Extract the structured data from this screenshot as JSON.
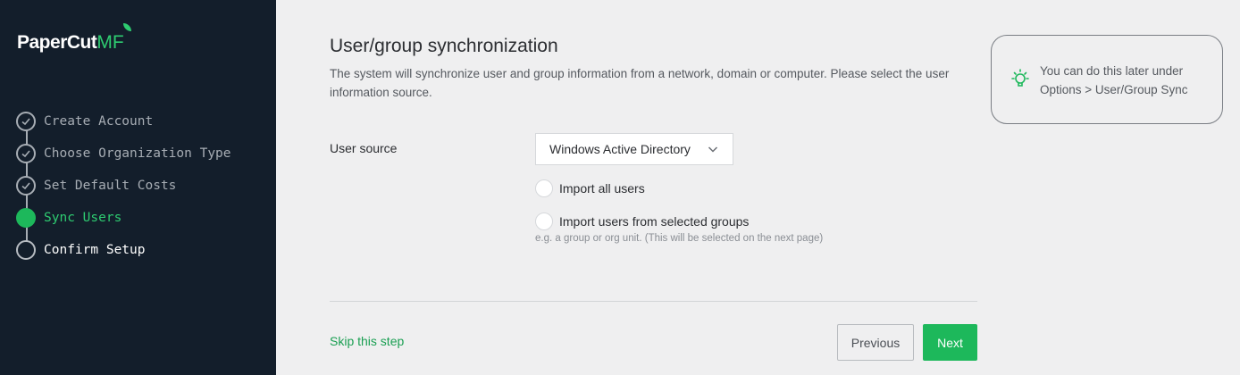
{
  "brand": {
    "name": "PaperCut",
    "suffix": "MF",
    "accent": "#1db85b"
  },
  "steps": [
    {
      "label": "Create Account",
      "state": "done",
      "icon": "check-icon"
    },
    {
      "label": "Choose Organization Type",
      "state": "done",
      "icon": "check-icon"
    },
    {
      "label": "Set Default Costs",
      "state": "done",
      "icon": "check-icon"
    },
    {
      "label": "Sync Users",
      "state": "active"
    },
    {
      "label": "Confirm Setup",
      "state": "pending"
    }
  ],
  "main": {
    "title": "User/group synchronization",
    "description": "The system will synchronize user and group information from a network, domain or computer. Please select the user information source.",
    "user_source_label": "User source",
    "user_source_value": "Windows Active Directory",
    "options": [
      {
        "label": "Import all users",
        "selected": false
      },
      {
        "label": "Import users from selected groups",
        "selected": false
      }
    ],
    "hint": "e.g. a group or org unit. (This will be selected on the next page)"
  },
  "footer": {
    "skip_label": "Skip this step",
    "previous_label": "Previous",
    "next_label": "Next"
  },
  "tip": {
    "icon": "lightbulb-icon",
    "text": "You can do this later under Options > User/Group Sync"
  }
}
